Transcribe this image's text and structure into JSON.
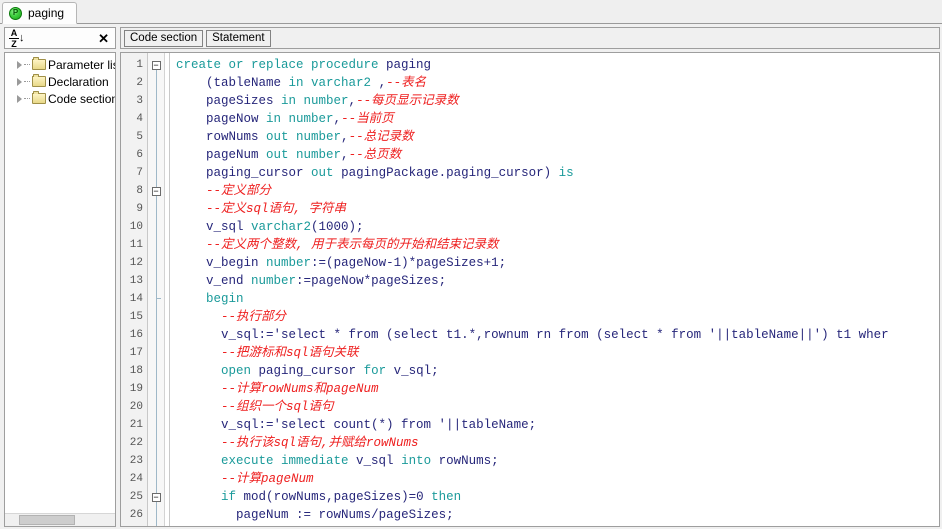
{
  "window": {
    "tab": {
      "label": "paging",
      "icon": "procedure-icon"
    }
  },
  "toolbar": {
    "sort_icon": "sort-az-icon",
    "sort_az_top": "A",
    "sort_az_bottom": "Z",
    "sort_arrow": "↓",
    "close_icon": "✕",
    "buttons": [
      {
        "label": "Code section",
        "name": "code-section-button"
      },
      {
        "label": "Statement",
        "name": "statement-button"
      }
    ]
  },
  "tree": {
    "items": [
      {
        "label": "Parameter lis",
        "icon": "folder-icon",
        "expander": "chevron-right-icon"
      },
      {
        "label": "Declaration",
        "icon": "folder-icon",
        "expander": "chevron-right-icon"
      },
      {
        "label": "Code section",
        "icon": "folder-icon",
        "expander": "chevron-right-icon"
      }
    ]
  },
  "editor": {
    "colors": {
      "keyword": "#1a9a9a",
      "identifier": "#26267a",
      "comment": "#ee2020",
      "gutter_bg": "#f2f2f2",
      "background": "#ffffff"
    },
    "first_line": 1,
    "last_line": 26,
    "fold_lines": [
      1,
      8,
      25
    ],
    "lines": [
      {
        "n": 1,
        "fold": "minus",
        "tokens": [
          {
            "t": "kw",
            "s": "create or replace procedure "
          },
          {
            "t": "id",
            "s": "paging"
          }
        ]
      },
      {
        "n": 2,
        "fold": "",
        "tokens": [
          {
            "t": "pl",
            "s": "    ("
          },
          {
            "t": "id",
            "s": "tableName"
          },
          {
            "t": "kw",
            "s": " in varchar2 "
          },
          {
            "t": "pl",
            "s": ","
          },
          {
            "t": "cm",
            "s": "--表名"
          }
        ]
      },
      {
        "n": 3,
        "fold": "",
        "tokens": [
          {
            "t": "pl",
            "s": "    "
          },
          {
            "t": "id",
            "s": "pageSizes"
          },
          {
            "t": "kw",
            "s": " in number"
          },
          {
            "t": "pl",
            "s": ","
          },
          {
            "t": "cm",
            "s": "--每页显示记录数"
          }
        ]
      },
      {
        "n": 4,
        "fold": "",
        "tokens": [
          {
            "t": "pl",
            "s": "    "
          },
          {
            "t": "id",
            "s": "pageNow"
          },
          {
            "t": "kw",
            "s": " in number"
          },
          {
            "t": "pl",
            "s": ","
          },
          {
            "t": "cm",
            "s": "--当前页"
          }
        ]
      },
      {
        "n": 5,
        "fold": "",
        "tokens": [
          {
            "t": "pl",
            "s": "    "
          },
          {
            "t": "id",
            "s": "rowNums"
          },
          {
            "t": "kw",
            "s": " out number"
          },
          {
            "t": "pl",
            "s": ","
          },
          {
            "t": "cm",
            "s": "--总记录数"
          }
        ]
      },
      {
        "n": 6,
        "fold": "",
        "tokens": [
          {
            "t": "pl",
            "s": "    "
          },
          {
            "t": "id",
            "s": "pageNum"
          },
          {
            "t": "kw",
            "s": " out number"
          },
          {
            "t": "pl",
            "s": ","
          },
          {
            "t": "cm",
            "s": "--总页数"
          }
        ]
      },
      {
        "n": 7,
        "fold": "",
        "tokens": [
          {
            "t": "pl",
            "s": "    "
          },
          {
            "t": "id",
            "s": "paging_cursor"
          },
          {
            "t": "kw",
            "s": " out "
          },
          {
            "t": "id",
            "s": "pagingPackage.paging_cursor"
          },
          {
            "t": "pl",
            "s": ") "
          },
          {
            "t": "kw",
            "s": "is"
          }
        ]
      },
      {
        "n": 8,
        "fold": "minus",
        "tokens": [
          {
            "t": "pl",
            "s": "    "
          },
          {
            "t": "cm",
            "s": "--定义部分"
          }
        ]
      },
      {
        "n": 9,
        "fold": "",
        "tokens": [
          {
            "t": "pl",
            "s": "    "
          },
          {
            "t": "cm",
            "s": "--定义sql语句, 字符串"
          }
        ]
      },
      {
        "n": 10,
        "fold": "",
        "tokens": [
          {
            "t": "pl",
            "s": "    "
          },
          {
            "t": "id",
            "s": "v_sql"
          },
          {
            "t": "kw",
            "s": " varchar2"
          },
          {
            "t": "pl",
            "s": "(1000);"
          }
        ]
      },
      {
        "n": 11,
        "fold": "",
        "tokens": [
          {
            "t": "pl",
            "s": "    "
          },
          {
            "t": "cm",
            "s": "--定义两个整数, 用于表示每页的开始和结束记录数"
          }
        ]
      },
      {
        "n": 12,
        "fold": "",
        "tokens": [
          {
            "t": "pl",
            "s": "    "
          },
          {
            "t": "id",
            "s": "v_begin"
          },
          {
            "t": "kw",
            "s": " number"
          },
          {
            "t": "pl",
            "s": ":=("
          },
          {
            "t": "id",
            "s": "pageNow"
          },
          {
            "t": "pl",
            "s": "-1)*"
          },
          {
            "t": "id",
            "s": "pageSizes"
          },
          {
            "t": "pl",
            "s": "+1;"
          }
        ]
      },
      {
        "n": 13,
        "fold": "",
        "tokens": [
          {
            "t": "pl",
            "s": "    "
          },
          {
            "t": "id",
            "s": "v_end"
          },
          {
            "t": "kw",
            "s": " number"
          },
          {
            "t": "pl",
            "s": ":="
          },
          {
            "t": "id",
            "s": "pageNow"
          },
          {
            "t": "pl",
            "s": "*"
          },
          {
            "t": "id",
            "s": "pageSizes"
          },
          {
            "t": "pl",
            "s": ";"
          }
        ]
      },
      {
        "n": 14,
        "fold": "",
        "tokens": [
          {
            "t": "pl",
            "s": "    "
          },
          {
            "t": "kw",
            "s": "begin"
          }
        ]
      },
      {
        "n": 15,
        "fold": "",
        "tokens": [
          {
            "t": "pl",
            "s": "      "
          },
          {
            "t": "cm",
            "s": "--执行部分"
          }
        ]
      },
      {
        "n": 16,
        "fold": "",
        "tokens": [
          {
            "t": "pl",
            "s": "      "
          },
          {
            "t": "id",
            "s": "v_sql"
          },
          {
            "t": "pl",
            "s": ":='select * from (select t1.*,rownum rn from (select * from '||tableName||') t1 wher"
          }
        ]
      },
      {
        "n": 17,
        "fold": "",
        "tokens": [
          {
            "t": "pl",
            "s": "      "
          },
          {
            "t": "cm",
            "s": "--把游标和sql语句关联"
          }
        ]
      },
      {
        "n": 18,
        "fold": "",
        "tokens": [
          {
            "t": "pl",
            "s": "      "
          },
          {
            "t": "kw",
            "s": "open "
          },
          {
            "t": "id",
            "s": "paging_cursor"
          },
          {
            "t": "kw",
            "s": " for "
          },
          {
            "t": "id",
            "s": "v_sql"
          },
          {
            "t": "pl",
            "s": ";"
          }
        ]
      },
      {
        "n": 19,
        "fold": "",
        "tokens": [
          {
            "t": "pl",
            "s": "      "
          },
          {
            "t": "cm",
            "s": "--计算rowNums和pageNum"
          }
        ]
      },
      {
        "n": 20,
        "fold": "",
        "tokens": [
          {
            "t": "pl",
            "s": "      "
          },
          {
            "t": "cm",
            "s": "--组织一个sql语句"
          }
        ]
      },
      {
        "n": 21,
        "fold": "",
        "tokens": [
          {
            "t": "pl",
            "s": "      "
          },
          {
            "t": "id",
            "s": "v_sql"
          },
          {
            "t": "pl",
            "s": ":='select count(*) from '||tableName;"
          }
        ]
      },
      {
        "n": 22,
        "fold": "",
        "tokens": [
          {
            "t": "pl",
            "s": "      "
          },
          {
            "t": "cm",
            "s": "--执行该sql语句,并赋给rowNums"
          }
        ]
      },
      {
        "n": 23,
        "fold": "",
        "tokens": [
          {
            "t": "pl",
            "s": "      "
          },
          {
            "t": "kw",
            "s": "execute immediate "
          },
          {
            "t": "id",
            "s": "v_sql"
          },
          {
            "t": "kw",
            "s": " into "
          },
          {
            "t": "id",
            "s": "rowNums"
          },
          {
            "t": "pl",
            "s": ";"
          }
        ]
      },
      {
        "n": 24,
        "fold": "",
        "tokens": [
          {
            "t": "pl",
            "s": "      "
          },
          {
            "t": "cm",
            "s": "--计算pageNum"
          }
        ]
      },
      {
        "n": 25,
        "fold": "minus",
        "tokens": [
          {
            "t": "pl",
            "s": "      "
          },
          {
            "t": "kw",
            "s": "if "
          },
          {
            "t": "id",
            "s": "mod"
          },
          {
            "t": "pl",
            "s": "("
          },
          {
            "t": "id",
            "s": "rowNums"
          },
          {
            "t": "pl",
            "s": ","
          },
          {
            "t": "id",
            "s": "pageSizes"
          },
          {
            "t": "pl",
            "s": ")=0 "
          },
          {
            "t": "kw",
            "s": "then"
          }
        ]
      },
      {
        "n": 26,
        "fold": "",
        "tokens": [
          {
            "t": "pl",
            "s": "        "
          },
          {
            "t": "id",
            "s": "pageNum"
          },
          {
            "t": "pl",
            "s": " := "
          },
          {
            "t": "id",
            "s": "rowNums"
          },
          {
            "t": "pl",
            "s": "/"
          },
          {
            "t": "id",
            "s": "pageSizes"
          },
          {
            "t": "pl",
            "s": ";"
          }
        ]
      }
    ]
  }
}
